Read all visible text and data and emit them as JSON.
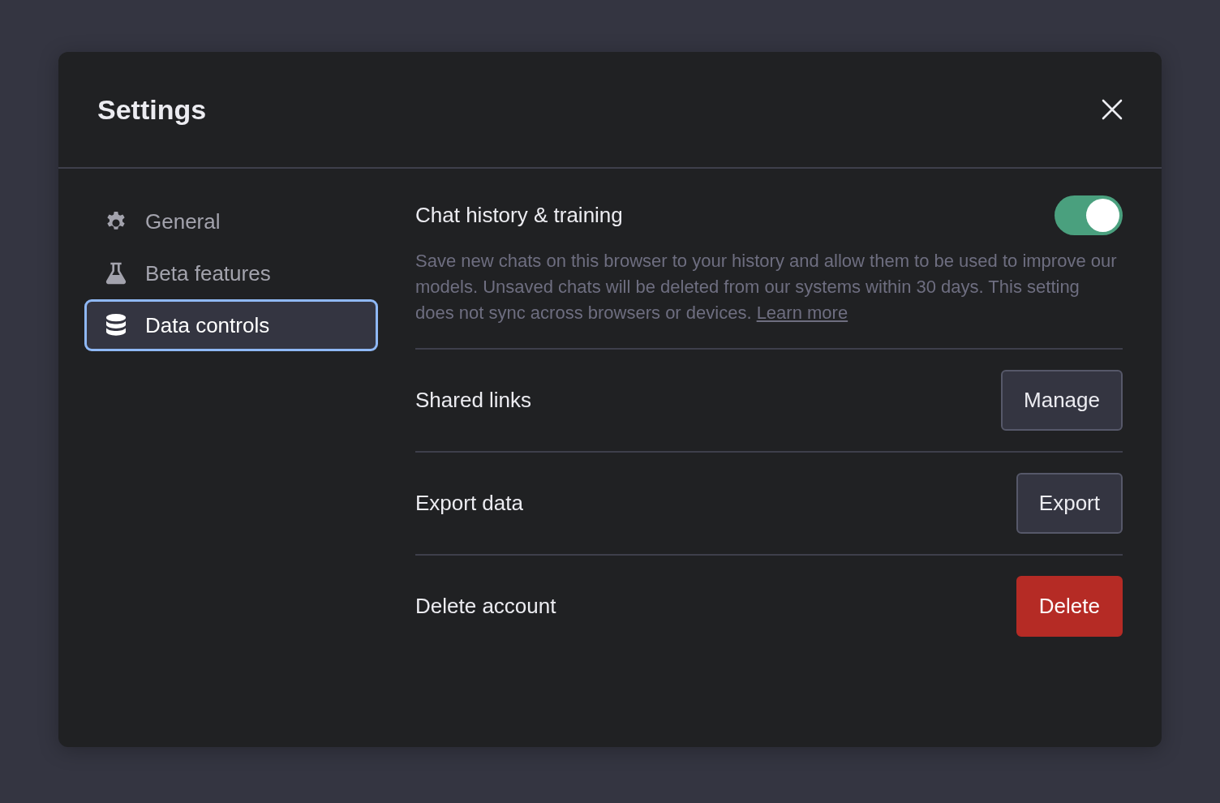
{
  "dialog": {
    "title": "Settings"
  },
  "sidebar": {
    "items": [
      {
        "label": "General",
        "selected": false
      },
      {
        "label": "Beta features",
        "selected": false
      },
      {
        "label": "Data controls",
        "selected": true
      }
    ]
  },
  "settings": [
    {
      "kind": "toggle",
      "label": "Chat history & training",
      "on": true,
      "description": "Save new chats on this browser to your history and allow them to be used to improve our models. Unsaved chats will be deleted from our systems within 30 days. This setting does not sync across browsers or devices.",
      "link": "Learn more"
    },
    {
      "kind": "button",
      "label": "Shared links",
      "button": "Manage",
      "danger": false
    },
    {
      "kind": "button",
      "label": "Export data",
      "button": "Export",
      "danger": false
    },
    {
      "kind": "button",
      "label": "Delete account",
      "button": "Delete",
      "danger": true
    }
  ]
}
